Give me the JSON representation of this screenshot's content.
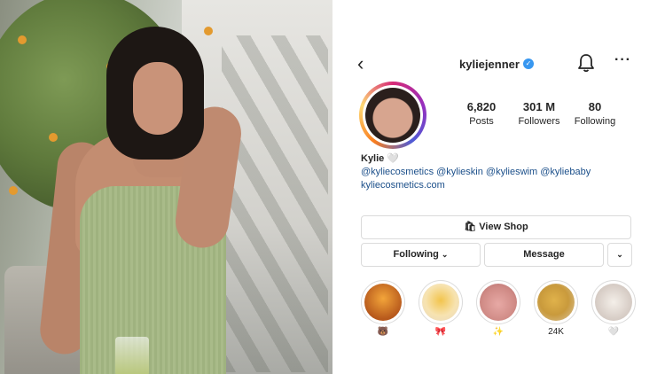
{
  "profile": {
    "username": "kyliejenner",
    "stats": [
      {
        "value": "6,820",
        "label": "Posts"
      },
      {
        "value": "301 M",
        "label": "Followers"
      },
      {
        "value": "80",
        "label": "Following"
      }
    ],
    "bio": {
      "name": "Kylie",
      "heart": "🤍",
      "tags": "@kyliecosmetics @kylieskin @kylieswim @kyliebaby",
      "link": "kyliecosmetics.com"
    },
    "buttons": {
      "view_shop": "View Shop",
      "following": "Following",
      "message": "Message",
      "more": "⌄"
    },
    "highlights": [
      {
        "caption": "🐻"
      },
      {
        "caption": "🎀"
      },
      {
        "caption": "✨"
      },
      {
        "caption": "24K"
      },
      {
        "caption": "🤍"
      }
    ]
  },
  "icons": {
    "back": "‹",
    "more": "···",
    "verified": "✓",
    "shop": "🛍"
  }
}
